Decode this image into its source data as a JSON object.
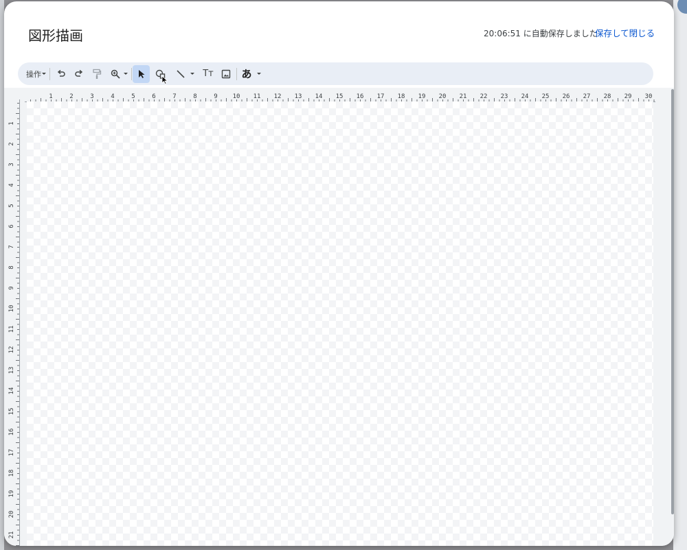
{
  "dialog": {
    "title": "図形描画",
    "autosave_text": "20:06:51 に自動保存しました",
    "save_close_label": "保存して閉じる"
  },
  "toolbar": {
    "actions_label": "操作",
    "items": [
      {
        "name": "actions-menu",
        "icon": "dropdown-arrow"
      },
      {
        "name": "undo",
        "icon": "undo-icon"
      },
      {
        "name": "redo",
        "icon": "redo-icon"
      },
      {
        "name": "paint-format",
        "icon": "paint-roller-icon"
      },
      {
        "name": "zoom",
        "icon": "zoom-icon"
      },
      {
        "name": "select",
        "icon": "cursor-arrow-icon",
        "active": true
      },
      {
        "name": "shape",
        "icon": "shape-icon"
      },
      {
        "name": "line",
        "icon": "line-icon"
      },
      {
        "name": "text-box",
        "icon": "text-box-icon"
      },
      {
        "name": "image",
        "icon": "image-icon"
      },
      {
        "name": "word-art",
        "icon": "word-art-icon"
      }
    ],
    "text_box_glyph": "Tт",
    "word_art_glyph": "あ",
    "accent_color": "#c2d7f5",
    "toolbar_bg": "#e9eef6"
  },
  "ruler": {
    "horizontal_labels": [
      "1",
      "2",
      "3",
      "4",
      "5",
      "6",
      "7",
      "8",
      "9",
      "10",
      "11",
      "12",
      "13",
      "14",
      "15",
      "16",
      "17",
      "18",
      "19",
      "20",
      "21",
      "22",
      "23",
      "24",
      "25",
      "26",
      "27",
      "28",
      "29",
      "30"
    ],
    "vertical_labels": [
      "1",
      "2",
      "3",
      "4",
      "5",
      "6",
      "7",
      "8",
      "9",
      "10",
      "11",
      "12",
      "13",
      "14",
      "15",
      "16",
      "17",
      "18",
      "19",
      "20",
      "21"
    ]
  },
  "colors": {
    "link": "#0b57d0",
    "title": "#1f1f1f"
  }
}
